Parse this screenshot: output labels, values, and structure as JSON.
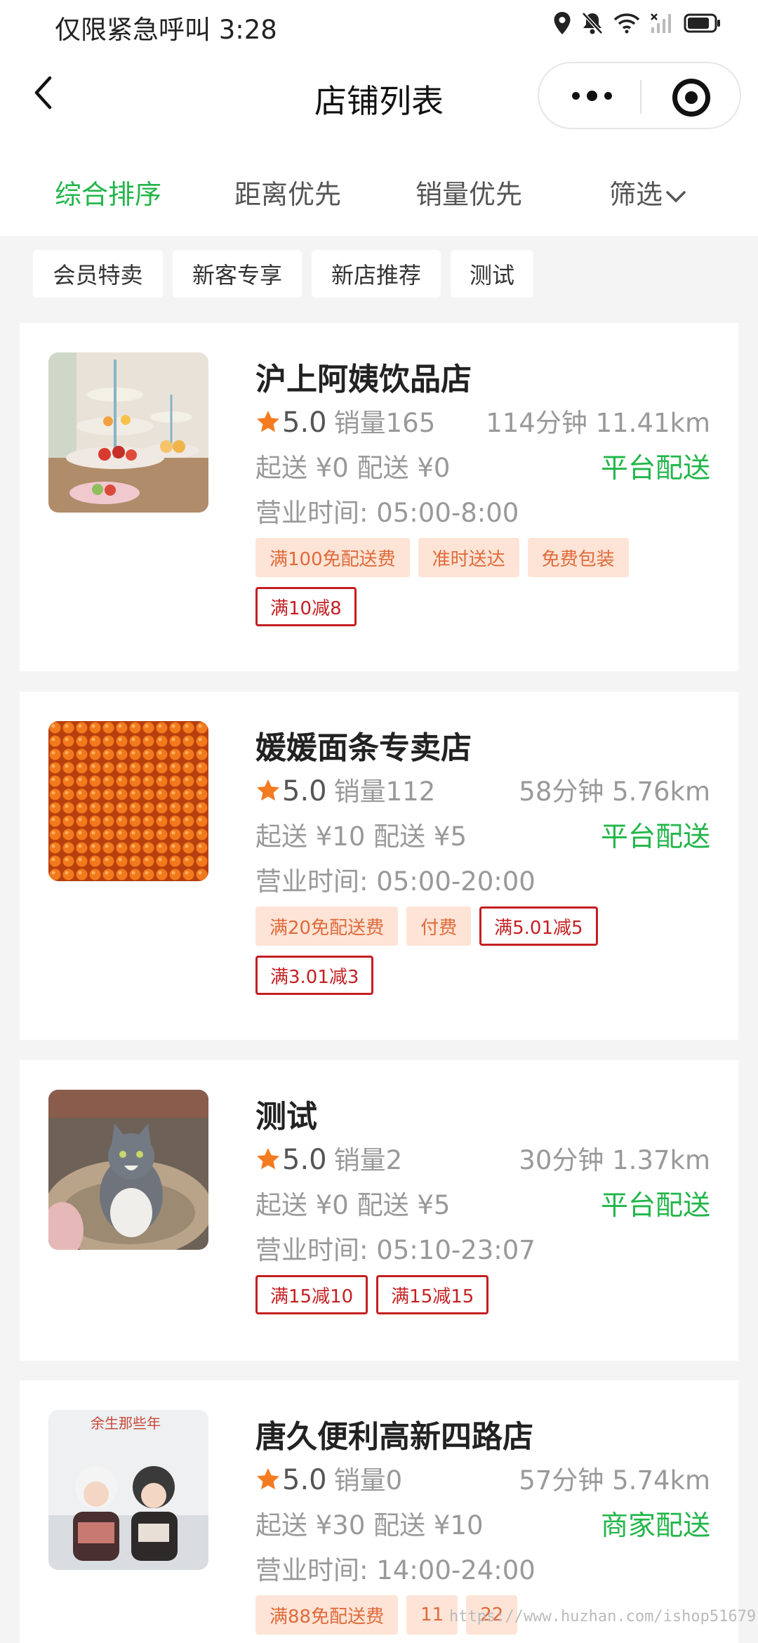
{
  "status_bar": {
    "text": "仅限紧急呼叫 3:28",
    "icons": [
      "location-icon",
      "mute-bell-icon",
      "wifi-icon",
      "signal-off-icon",
      "battery-icon"
    ]
  },
  "nav": {
    "title": "店铺列表",
    "back_icon": "chevron-left-icon",
    "more_icon": "more-dots-icon",
    "close_icon": "target-circle-icon"
  },
  "sort_tabs": [
    {
      "label": "综合排序",
      "active": true
    },
    {
      "label": "距离优先",
      "active": false
    },
    {
      "label": "销量优先",
      "active": false
    },
    {
      "label": "筛选",
      "active": false,
      "icon": "chevron-down-icon"
    }
  ],
  "filter_chips": [
    "会员特卖",
    "新客专享",
    "新店推荐",
    "测试"
  ],
  "stores": [
    {
      "name": "沪上阿姨饮品店",
      "rating": "5.0",
      "sales": "销量165",
      "eta_distance": "114分钟 11.41km",
      "fees": "起送 ¥0 配送 ¥0",
      "delivery": "平台配送",
      "hours": "营业时间: 05:00-8:00",
      "tags": [
        {
          "text": "满100免配送费",
          "style": "fill"
        },
        {
          "text": "准时送达",
          "style": "fill"
        },
        {
          "text": "免费包装",
          "style": "fill"
        },
        {
          "text": "满10减8",
          "style": "outline"
        }
      ]
    },
    {
      "name": "媛媛面条专卖店",
      "rating": "5.0",
      "sales": "销量112",
      "eta_distance": "58分钟 5.76km",
      "fees": "起送 ¥10 配送 ¥5",
      "delivery": "平台配送",
      "hours": "营业时间: 05:00-20:00",
      "tags": [
        {
          "text": "满20免配送费",
          "style": "fill"
        },
        {
          "text": "付费",
          "style": "fill"
        },
        {
          "text": "满5.01减5",
          "style": "outline"
        },
        {
          "text": "满3.01减3",
          "style": "outline"
        }
      ]
    },
    {
      "name": "测试",
      "rating": "5.0",
      "sales": "销量2",
      "eta_distance": "30分钟 1.37km",
      "fees": "起送 ¥0 配送 ¥5",
      "delivery": "平台配送",
      "hours": "营业时间: 05:10-23:07",
      "tags": [
        {
          "text": "满15减10",
          "style": "outline"
        },
        {
          "text": "满15减15",
          "style": "outline"
        }
      ]
    },
    {
      "name": "唐久便利高新四路店",
      "rating": "5.0",
      "sales": "销量0",
      "eta_distance": "57分钟 5.74km",
      "fees": "起送 ¥30 配送 ¥10",
      "delivery": "商家配送",
      "hours": "营业时间: 14:00-24:00",
      "tags": [
        {
          "text": "满88免配送费",
          "style": "fill"
        },
        {
          "text": "11",
          "style": "fill"
        },
        {
          "text": "22",
          "style": "fill"
        }
      ]
    }
  ],
  "thumb_captions": {
    "store_4": "余生那些年"
  },
  "watermark": "https://www.huzhan.com/ishop51679",
  "colors": {
    "accent_green": "#22b64a",
    "star_orange": "#f47b20",
    "tag_fill_bg": "#fde4d6",
    "tag_fill_text": "#e06a3a",
    "tag_outline": "#c41f22"
  }
}
